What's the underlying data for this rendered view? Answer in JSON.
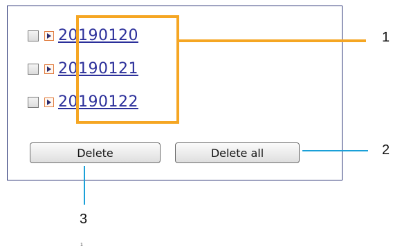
{
  "folders": [
    {
      "label": "20190120"
    },
    {
      "label": "20190121"
    },
    {
      "label": "20190122"
    }
  ],
  "buttons": {
    "delete_label": "Delete",
    "delete_all_label": "Delete all"
  },
  "callouts": {
    "one": "1",
    "two": "2",
    "three": "3",
    "footnote": "1"
  },
  "colors": {
    "panel_border": "#2b3576",
    "highlight": "#f5a623",
    "callout_line": "#1aa0d8",
    "link": "#2b2f9a",
    "arrow_icon_border": "#e07a3c"
  },
  "icons": {
    "row_icon": "arrow-right-icon"
  }
}
